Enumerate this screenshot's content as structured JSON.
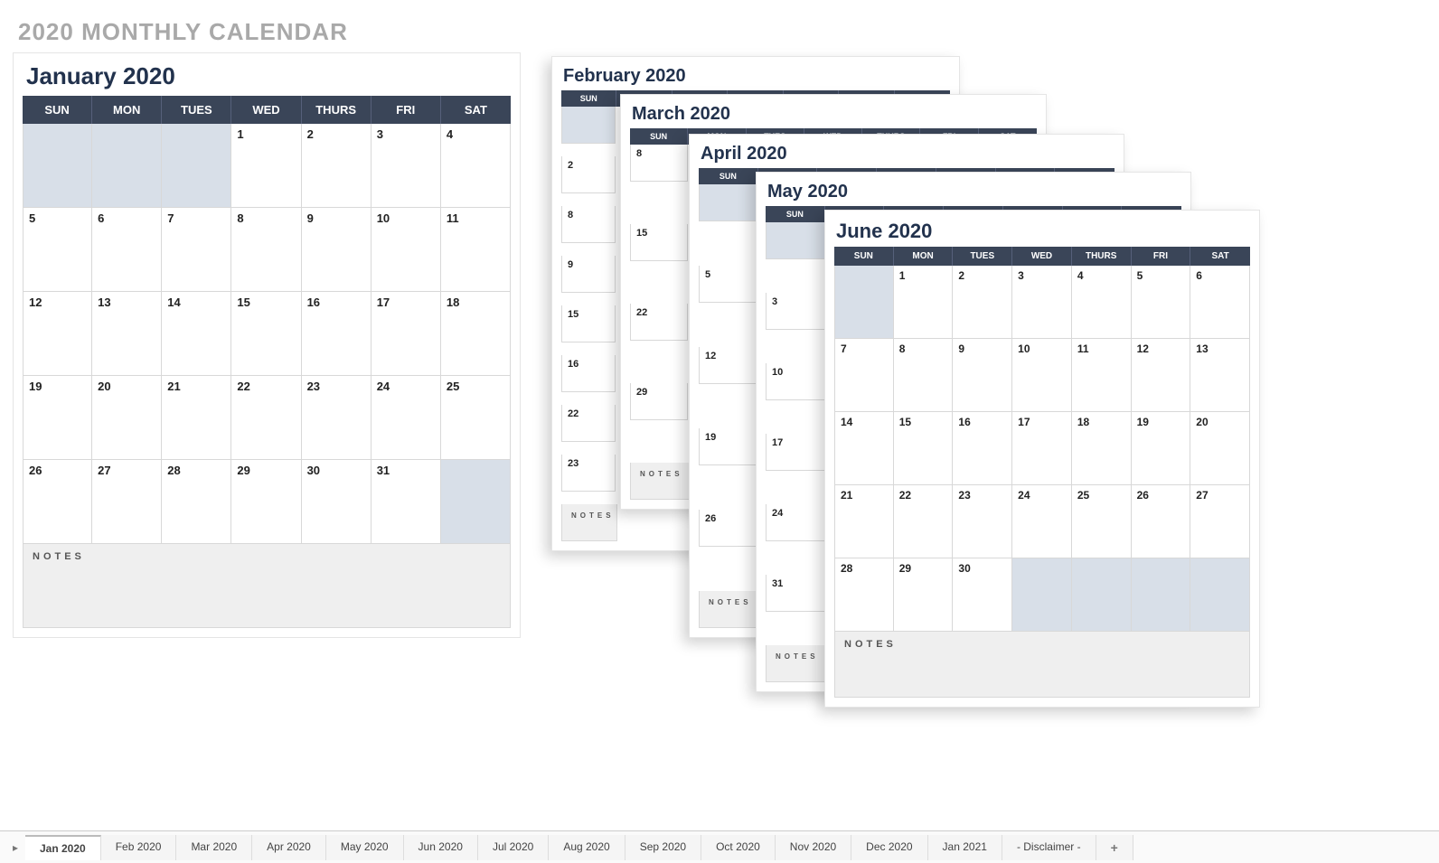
{
  "page_title": "2020 MONTHLY CALENDAR",
  "day_headers": [
    "SUN",
    "MON",
    "TUES",
    "WED",
    "THURS",
    "FRI",
    "SAT"
  ],
  "notes_label": "NOTES",
  "months": {
    "jan": {
      "title": "January 2020",
      "lead_blanks": 3,
      "days": 31,
      "trail_blanks": 1
    },
    "feb": {
      "title": "February 2020",
      "col_days": [
        "2",
        "8",
        "9",
        "15",
        "16",
        "22",
        "23"
      ]
    },
    "mar": {
      "title": "March 2020",
      "col_days": [
        "8",
        "15",
        "22",
        "29"
      ]
    },
    "apr": {
      "title": "April 2020",
      "col_days": [
        "5",
        "12",
        "19",
        "26"
      ]
    },
    "may": {
      "title": "May 2020",
      "col_days": [
        "3",
        "10",
        "17",
        "24",
        "31"
      ]
    },
    "jun": {
      "title": "June 2020",
      "lead_blanks": 1,
      "days": 30,
      "trail_blanks": 4
    }
  },
  "tabs": [
    "Jan 2020",
    "Feb 2020",
    "Mar 2020",
    "Apr 2020",
    "May 2020",
    "Jun 2020",
    "Jul 2020",
    "Aug 2020",
    "Sep 2020",
    "Oct 2020",
    "Nov 2020",
    "Dec 2020",
    "Jan 2021",
    "- Disclaimer -"
  ],
  "active_tab": 0
}
